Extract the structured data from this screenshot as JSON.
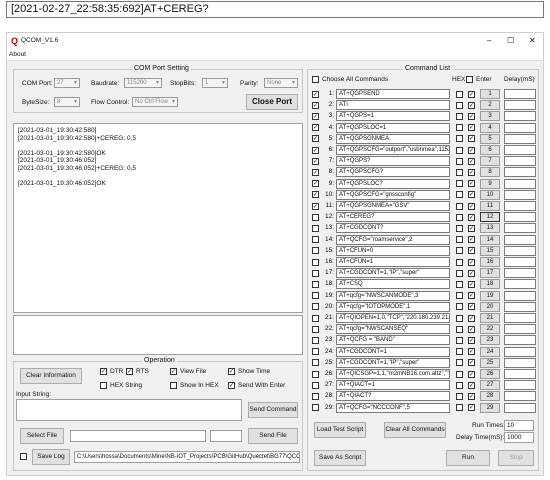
{
  "top_note": "[2021-02-27_22:58:35:692]AT+CEREG?",
  "window": {
    "title": "QCOM_V1.6",
    "minimize": "–",
    "maximize": "☐",
    "close": "✕"
  },
  "menu": {
    "about": "About"
  },
  "com_setting": {
    "title": "COM Port Setting",
    "com_port_label": "COM Port:",
    "com_port_value": "27",
    "baudrate_label": "Baudrate:",
    "baudrate_value": "115200",
    "stopbits_label": "StopBits:",
    "stopbits_value": "1",
    "parity_label": "Parity:",
    "parity_value": "None",
    "bytesize_label": "ByteSize:",
    "bytesize_value": "8",
    "flow_label": "Flow Control:",
    "flow_value": "No Ctrl Flow",
    "close_port": "Close Port"
  },
  "log_lines": [
    "[2021-03-01_19:30:42:580]",
    "[2021-03-01_19:30:42:580]+CEREG: 0,5",
    "",
    "[2021-03-01_19:30:42:580]OK",
    "[2021-03-01_19:30:46:052]",
    "[2021-03-01_19:30:46:052]+CEREG: 0,5",
    "",
    "[2021-03-01_19:30:46:052]OK"
  ],
  "operation": {
    "title": "Operation",
    "clear_info": "Clear Information",
    "dtr": "DTR",
    "rts": "RTS",
    "view_file": "View File",
    "show_time": "Show Time",
    "hex_string": "HEX String",
    "show_in_hex": "Show In HEX",
    "send_with_enter": "Send With Enter",
    "input_string": "Input String:",
    "send_command": "Send Command",
    "select_file": "Select File",
    "send_file": "Send File",
    "save_log": "Save Log",
    "log_path": "C:\\Users\\hossa\\Documents\\Mine\\NB-IOT_Projects\\PCB\\GitHub\\Quectel\\BG77\\QCC"
  },
  "command_list": {
    "title": "Command List",
    "choose_all": "Choose All Commands",
    "hex_label": "HEX",
    "enter_label": "Enter",
    "delay_label": "Delay(mS)",
    "rows": [
      {
        "num": "1:",
        "cmd": "AT+QGPSEND",
        "checked": true,
        "btn": "1"
      },
      {
        "num": "2:",
        "cmd": "ATI",
        "checked": true,
        "btn": "2"
      },
      {
        "num": "3:",
        "cmd": "AT+QGPS=1",
        "checked": true,
        "btn": "3"
      },
      {
        "num": "4:",
        "cmd": "AT+QGPSLOC=1",
        "checked": true,
        "btn": "4"
      },
      {
        "num": "5:",
        "cmd": "AT+QGPSGNMEA",
        "checked": true,
        "btn": "5"
      },
      {
        "num": "6:",
        "cmd": "AT+QGPSCFG=\"outport\",\"usbnmea\",115200",
        "checked": true,
        "btn": "6"
      },
      {
        "num": "7:",
        "cmd": "AT+QGPS?",
        "checked": true,
        "btn": "7"
      },
      {
        "num": "8:",
        "cmd": "AT+QGPSCFG?",
        "checked": true,
        "btn": "8"
      },
      {
        "num": "9:",
        "cmd": "AT+QGPSLOC?",
        "checked": true,
        "btn": "9"
      },
      {
        "num": "10:",
        "cmd": "AT+QGPSCFG=\"gnssconfig\"",
        "checked": true,
        "btn": "10"
      },
      {
        "num": "11:",
        "cmd": "AT+QGPSGNMEA=\"GSV\"",
        "checked": true,
        "btn": "11"
      },
      {
        "num": "12:",
        "cmd": "AT+CEREG?",
        "checked": false,
        "btn": "12"
      },
      {
        "num": "13:",
        "cmd": "AT+CGDCONT?",
        "checked": false,
        "btn": "13"
      },
      {
        "num": "14:",
        "cmd": "AT+QCFG=\"roamservice\",2",
        "checked": false,
        "btn": "14"
      },
      {
        "num": "15:",
        "cmd": "AT+CFUN=0",
        "checked": false,
        "btn": "15"
      },
      {
        "num": "16:",
        "cmd": "AT+CFUN=1",
        "checked": false,
        "btn": "16"
      },
      {
        "num": "17:",
        "cmd": "AT+CGDCONT=1,\"IP\",\"super\"",
        "checked": false,
        "btn": "17"
      },
      {
        "num": "18:",
        "cmd": "AT+CSQ",
        "checked": false,
        "btn": "18"
      },
      {
        "num": "19:",
        "cmd": "AT+qcfg=\"NWSCANMODE\",3",
        "checked": false,
        "btn": "19"
      },
      {
        "num": "20:",
        "cmd": "AT+qcfg=\"IOTOPMODE\",1",
        "checked": false,
        "btn": "20"
      },
      {
        "num": "21:",
        "cmd": "AT+QIOPEN=1,0,\"TCP\",\"220.180.239.212\"",
        "checked": false,
        "btn": "21"
      },
      {
        "num": "22:",
        "cmd": "AT+qcfg=\"NWSCANSEQ\"",
        "checked": false,
        "btn": "22"
      },
      {
        "num": "23:",
        "cmd": "AT+QCFG = \"BAND\"",
        "checked": false,
        "btn": "23"
      },
      {
        "num": "24:",
        "cmd": "AT+CGDCONT=1",
        "checked": false,
        "btn": "24"
      },
      {
        "num": "25:",
        "cmd": "AT+CGDCONT=1,\"IP\",\"super\"",
        "checked": false,
        "btn": "25"
      },
      {
        "num": "26:",
        "cmd": "AT+QICSGP=1,1,\"m2mNB16.com.attz\",\"\",\"\"",
        "checked": false,
        "btn": "26"
      },
      {
        "num": "27:",
        "cmd": "AT+QIACT=1",
        "checked": false,
        "btn": "27"
      },
      {
        "num": "28:",
        "cmd": "AT+QIACT?",
        "checked": false,
        "btn": "28"
      },
      {
        "num": "29:",
        "cmd": "AT+QCFG=\"NCCCONF\",5",
        "checked": false,
        "btn": "29"
      }
    ],
    "load_test_script": "Load Test Script",
    "clear_all_commands": "Clear All Commands",
    "run_times_label": "Run Times:",
    "run_times_value": "10",
    "delay_time_label": "Delay Time(mS):",
    "delay_time_value": "1000",
    "save_as_script": "Save As Script",
    "run": "Run",
    "stop": "Stop"
  }
}
